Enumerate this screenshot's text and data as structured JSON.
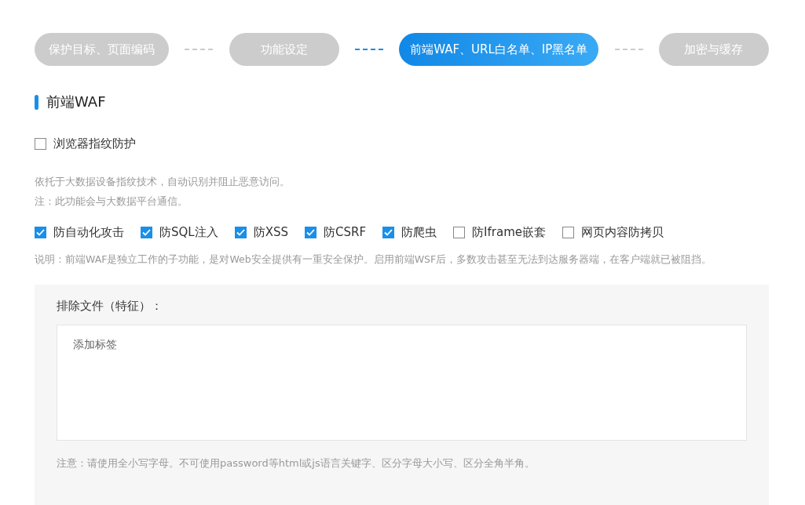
{
  "steps": [
    {
      "label": "保护目标、页面编码",
      "selected": false
    },
    {
      "label": "功能设定",
      "selected": false
    },
    {
      "label": "前端WAF、URL白名单、IP黑名单",
      "selected": true
    },
    {
      "label": "加密与缓存",
      "selected": false
    }
  ],
  "section_title": "前端WAF",
  "fingerprint": {
    "label": "浏览器指纹防护",
    "checked": false
  },
  "fingerprint_notes": [
    "依托于大数据设备指纹技术，自动识别并阻止恶意访问。",
    "注：此功能会与大数据平台通信。"
  ],
  "protections": [
    {
      "label": "防自动化攻击",
      "checked": true
    },
    {
      "label": "防SQL注入",
      "checked": true
    },
    {
      "label": "防XSS",
      "checked": true
    },
    {
      "label": "防CSRF",
      "checked": true
    },
    {
      "label": "防爬虫",
      "checked": true
    },
    {
      "label": "防Iframe嵌套",
      "checked": false
    },
    {
      "label": "网页内容防拷贝",
      "checked": false
    }
  ],
  "protections_note": "说明：前端WAF是独立工作的子功能，是对Web安全提供有一重安全保护。启用前端WSF后，多数攻击甚至无法到达服务器端，在客户端就已被阻挡。",
  "exclude_panel": {
    "label": "排除文件（特征）：",
    "placeholder": "添加标签",
    "note": "注意：请使用全小写字母。不可使用password等html或js语言关键字、区分字母大小写、区分全角半角。"
  }
}
